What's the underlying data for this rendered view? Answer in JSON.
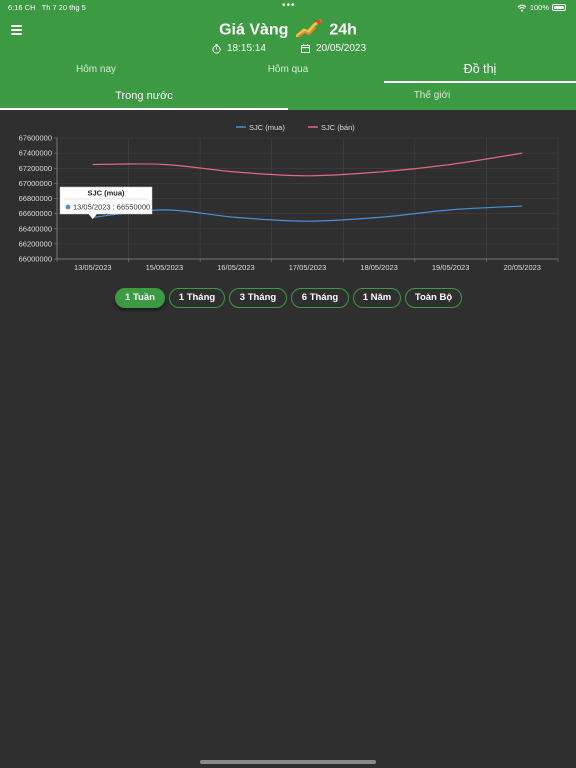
{
  "status_bar": {
    "time": "6:16 CH",
    "date": "Th 7 20 thg 5",
    "battery": "100%"
  },
  "header": {
    "title_left": "Giá Vàng",
    "title_right": "24h",
    "time": "18:15:14",
    "date": "20/05/2023"
  },
  "tabs_primary": [
    {
      "label": "Hôm nay"
    },
    {
      "label": "Hôm qua"
    },
    {
      "label": "Đồ thị"
    }
  ],
  "tabs_secondary": [
    {
      "label": "Trong nước"
    },
    {
      "label": "Thế giới"
    }
  ],
  "colors": {
    "header": "#3c9a43",
    "series_buy": "#4a90d9",
    "series_sell": "#e06a80",
    "background": "#2f2f2f"
  },
  "chart_data": {
    "type": "line",
    "categories": [
      "13/05/2023",
      "15/05/2023",
      "16/05/2023",
      "17/05/2023",
      "18/05/2023",
      "19/05/2023",
      "20/05/2023"
    ],
    "series": [
      {
        "name": "SJC (mua)",
        "values": [
          66550000,
          66650000,
          66550000,
          66500000,
          66550000,
          66650000,
          66700000
        ]
      },
      {
        "name": "SJC (bán)",
        "values": [
          67250000,
          67250000,
          67150000,
          67100000,
          67150000,
          67250000,
          67400000
        ]
      }
    ],
    "ylim": [
      66000000,
      67600000
    ],
    "yticks": [
      66000000,
      66200000,
      66400000,
      66600000,
      66800000,
      67000000,
      67200000,
      67400000,
      67600000
    ],
    "legend_position": "top-center",
    "grid": true,
    "tooltip": {
      "title": "SJC (mua)",
      "text": "13/05/2023 : 66550000"
    }
  },
  "ranges": [
    {
      "label": "1 Tuần",
      "active": true
    },
    {
      "label": "1 Tháng",
      "active": false
    },
    {
      "label": "3 Tháng",
      "active": false
    },
    {
      "label": "6 Tháng",
      "active": false
    },
    {
      "label": "1 Năm",
      "active": false
    },
    {
      "label": "Toàn Bộ",
      "active": false
    }
  ]
}
